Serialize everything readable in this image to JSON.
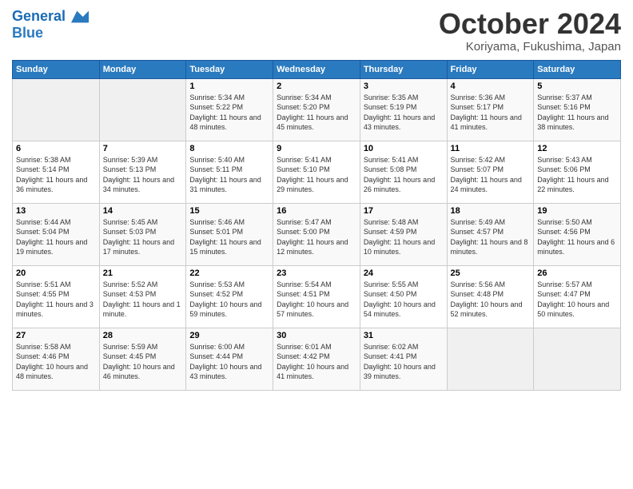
{
  "header": {
    "logo_line1": "General",
    "logo_line2": "Blue",
    "month_title": "October 2024",
    "location": "Koriyama, Fukushima, Japan"
  },
  "weekdays": [
    "Sunday",
    "Monday",
    "Tuesday",
    "Wednesday",
    "Thursday",
    "Friday",
    "Saturday"
  ],
  "weeks": [
    [
      {
        "day": "",
        "sunrise": "",
        "sunset": "",
        "daylight": "",
        "empty": true
      },
      {
        "day": "",
        "sunrise": "",
        "sunset": "",
        "daylight": "",
        "empty": true
      },
      {
        "day": "1",
        "sunrise": "Sunrise: 5:34 AM",
        "sunset": "Sunset: 5:22 PM",
        "daylight": "Daylight: 11 hours and 48 minutes."
      },
      {
        "day": "2",
        "sunrise": "Sunrise: 5:34 AM",
        "sunset": "Sunset: 5:20 PM",
        "daylight": "Daylight: 11 hours and 45 minutes."
      },
      {
        "day": "3",
        "sunrise": "Sunrise: 5:35 AM",
        "sunset": "Sunset: 5:19 PM",
        "daylight": "Daylight: 11 hours and 43 minutes."
      },
      {
        "day": "4",
        "sunrise": "Sunrise: 5:36 AM",
        "sunset": "Sunset: 5:17 PM",
        "daylight": "Daylight: 11 hours and 41 minutes."
      },
      {
        "day": "5",
        "sunrise": "Sunrise: 5:37 AM",
        "sunset": "Sunset: 5:16 PM",
        "daylight": "Daylight: 11 hours and 38 minutes."
      }
    ],
    [
      {
        "day": "6",
        "sunrise": "Sunrise: 5:38 AM",
        "sunset": "Sunset: 5:14 PM",
        "daylight": "Daylight: 11 hours and 36 minutes."
      },
      {
        "day": "7",
        "sunrise": "Sunrise: 5:39 AM",
        "sunset": "Sunset: 5:13 PM",
        "daylight": "Daylight: 11 hours and 34 minutes."
      },
      {
        "day": "8",
        "sunrise": "Sunrise: 5:40 AM",
        "sunset": "Sunset: 5:11 PM",
        "daylight": "Daylight: 11 hours and 31 minutes."
      },
      {
        "day": "9",
        "sunrise": "Sunrise: 5:41 AM",
        "sunset": "Sunset: 5:10 PM",
        "daylight": "Daylight: 11 hours and 29 minutes."
      },
      {
        "day": "10",
        "sunrise": "Sunrise: 5:41 AM",
        "sunset": "Sunset: 5:08 PM",
        "daylight": "Daylight: 11 hours and 26 minutes."
      },
      {
        "day": "11",
        "sunrise": "Sunrise: 5:42 AM",
        "sunset": "Sunset: 5:07 PM",
        "daylight": "Daylight: 11 hours and 24 minutes."
      },
      {
        "day": "12",
        "sunrise": "Sunrise: 5:43 AM",
        "sunset": "Sunset: 5:06 PM",
        "daylight": "Daylight: 11 hours and 22 minutes."
      }
    ],
    [
      {
        "day": "13",
        "sunrise": "Sunrise: 5:44 AM",
        "sunset": "Sunset: 5:04 PM",
        "daylight": "Daylight: 11 hours and 19 minutes."
      },
      {
        "day": "14",
        "sunrise": "Sunrise: 5:45 AM",
        "sunset": "Sunset: 5:03 PM",
        "daylight": "Daylight: 11 hours and 17 minutes."
      },
      {
        "day": "15",
        "sunrise": "Sunrise: 5:46 AM",
        "sunset": "Sunset: 5:01 PM",
        "daylight": "Daylight: 11 hours and 15 minutes."
      },
      {
        "day": "16",
        "sunrise": "Sunrise: 5:47 AM",
        "sunset": "Sunset: 5:00 PM",
        "daylight": "Daylight: 11 hours and 12 minutes."
      },
      {
        "day": "17",
        "sunrise": "Sunrise: 5:48 AM",
        "sunset": "Sunset: 4:59 PM",
        "daylight": "Daylight: 11 hours and 10 minutes."
      },
      {
        "day": "18",
        "sunrise": "Sunrise: 5:49 AM",
        "sunset": "Sunset: 4:57 PM",
        "daylight": "Daylight: 11 hours and 8 minutes."
      },
      {
        "day": "19",
        "sunrise": "Sunrise: 5:50 AM",
        "sunset": "Sunset: 4:56 PM",
        "daylight": "Daylight: 11 hours and 6 minutes."
      }
    ],
    [
      {
        "day": "20",
        "sunrise": "Sunrise: 5:51 AM",
        "sunset": "Sunset: 4:55 PM",
        "daylight": "Daylight: 11 hours and 3 minutes."
      },
      {
        "day": "21",
        "sunrise": "Sunrise: 5:52 AM",
        "sunset": "Sunset: 4:53 PM",
        "daylight": "Daylight: 11 hours and 1 minute."
      },
      {
        "day": "22",
        "sunrise": "Sunrise: 5:53 AM",
        "sunset": "Sunset: 4:52 PM",
        "daylight": "Daylight: 10 hours and 59 minutes."
      },
      {
        "day": "23",
        "sunrise": "Sunrise: 5:54 AM",
        "sunset": "Sunset: 4:51 PM",
        "daylight": "Daylight: 10 hours and 57 minutes."
      },
      {
        "day": "24",
        "sunrise": "Sunrise: 5:55 AM",
        "sunset": "Sunset: 4:50 PM",
        "daylight": "Daylight: 10 hours and 54 minutes."
      },
      {
        "day": "25",
        "sunrise": "Sunrise: 5:56 AM",
        "sunset": "Sunset: 4:48 PM",
        "daylight": "Daylight: 10 hours and 52 minutes."
      },
      {
        "day": "26",
        "sunrise": "Sunrise: 5:57 AM",
        "sunset": "Sunset: 4:47 PM",
        "daylight": "Daylight: 10 hours and 50 minutes."
      }
    ],
    [
      {
        "day": "27",
        "sunrise": "Sunrise: 5:58 AM",
        "sunset": "Sunset: 4:46 PM",
        "daylight": "Daylight: 10 hours and 48 minutes."
      },
      {
        "day": "28",
        "sunrise": "Sunrise: 5:59 AM",
        "sunset": "Sunset: 4:45 PM",
        "daylight": "Daylight: 10 hours and 46 minutes."
      },
      {
        "day": "29",
        "sunrise": "Sunrise: 6:00 AM",
        "sunset": "Sunset: 4:44 PM",
        "daylight": "Daylight: 10 hours and 43 minutes."
      },
      {
        "day": "30",
        "sunrise": "Sunrise: 6:01 AM",
        "sunset": "Sunset: 4:42 PM",
        "daylight": "Daylight: 10 hours and 41 minutes."
      },
      {
        "day": "31",
        "sunrise": "Sunrise: 6:02 AM",
        "sunset": "Sunset: 4:41 PM",
        "daylight": "Daylight: 10 hours and 39 minutes."
      },
      {
        "day": "",
        "sunrise": "",
        "sunset": "",
        "daylight": "",
        "empty": true
      },
      {
        "day": "",
        "sunrise": "",
        "sunset": "",
        "daylight": "",
        "empty": true
      }
    ]
  ]
}
